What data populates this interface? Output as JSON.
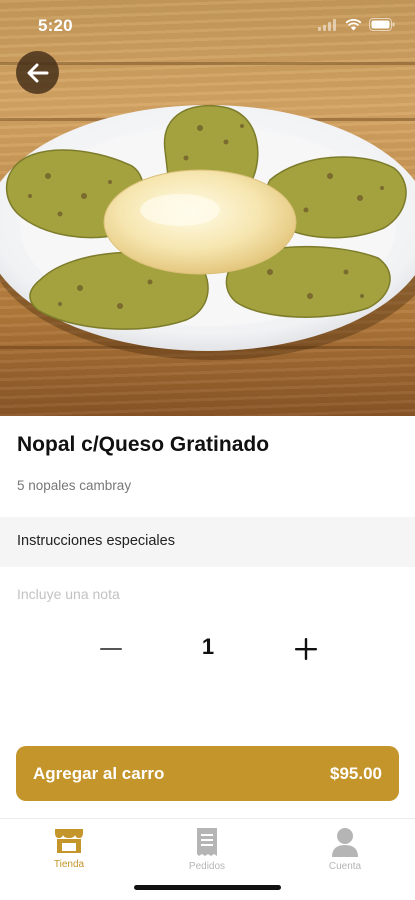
{
  "status_bar": {
    "time": "5:20"
  },
  "product": {
    "title": "Nopal c/Queso Gratinado",
    "description": "5 nopales cambray"
  },
  "special_instructions": {
    "header": "Instrucciones especiales",
    "note_placeholder": "Incluye una nota",
    "note_value": ""
  },
  "quantity": {
    "value": "1",
    "minus_symbol": "−",
    "plus_symbol": "+"
  },
  "cart_button": {
    "label": "Agregar al carro",
    "price": "$95.00"
  },
  "tab_bar": {
    "tabs": [
      {
        "label": "Tienda",
        "icon": "store-icon",
        "active": true
      },
      {
        "label": "Pedidos",
        "icon": "receipt-icon",
        "active": false
      },
      {
        "label": "Cuenta",
        "icon": "person-icon",
        "active": false
      }
    ]
  },
  "colors": {
    "accent": "#c4952a",
    "inactive_tab": "#b5b5b5",
    "section_bg": "#f5f5f5"
  }
}
